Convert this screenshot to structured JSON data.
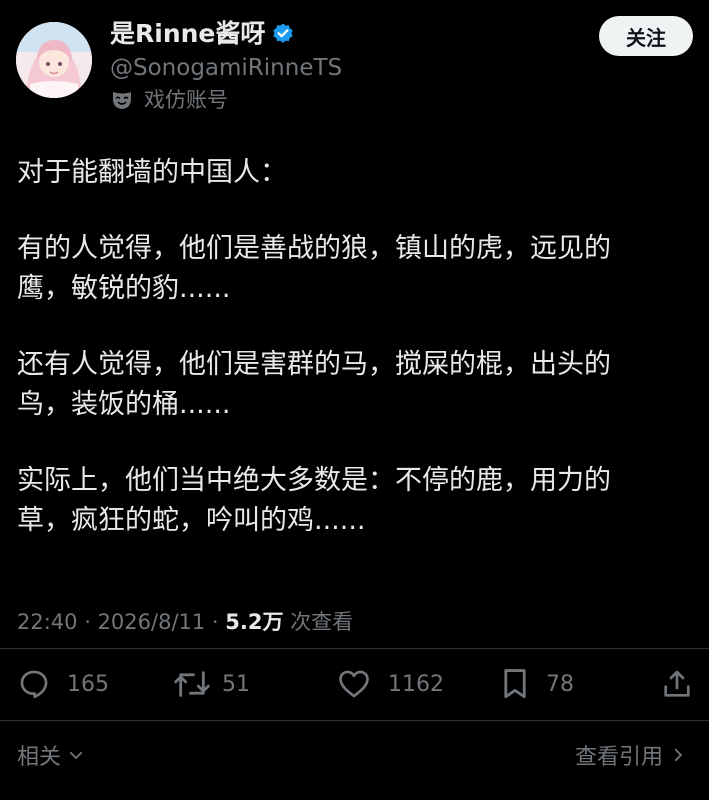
{
  "user": {
    "display_name": "是Rinne酱呀",
    "handle": "@SonogamiRinneTS",
    "account_label": "戏仿账号",
    "follow_label": "关注",
    "verified_color": "#1d9bf0"
  },
  "tweet": {
    "paragraphs": [
      [
        "对于能翻墙的中国人："
      ],
      [
        "有的人觉得，他们是善战的狼，镇山的虎，远见的",
        "鹰，敏锐的豹......"
      ],
      [
        "还有人觉得，他们是害群的马，搅屎的棍，出头的",
        "鸟，装饭的桶......"
      ],
      [
        "实际上，他们当中绝大多数是：不停的鹿，用力的",
        "草，疯狂的蛇，吟叫的鸡......"
      ]
    ]
  },
  "meta": {
    "time": "22:40",
    "separator_1": " · ",
    "date": "2026/8/11",
    "separator_2": " · ",
    "views": "5.2万",
    "views_label": " 次查看"
  },
  "actions": {
    "replies": "165",
    "reposts": "51",
    "likes": "1162",
    "bookmarks": "78"
  },
  "icons": {
    "reply": "reply-icon",
    "repost": "repost-icon",
    "like": "heart-icon",
    "bookmark": "bookmark-icon",
    "share": "share-icon",
    "parody": "mask-icon",
    "verified": "verified-badge-icon"
  },
  "footer": {
    "related_label": "相关",
    "view_quotes_label": "查看引用"
  }
}
